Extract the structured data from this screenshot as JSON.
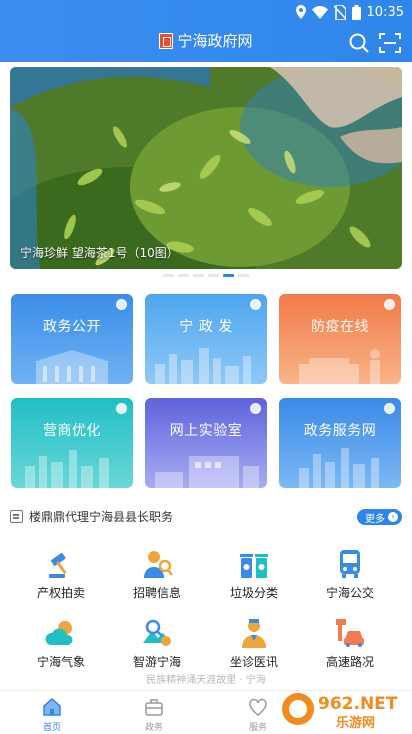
{
  "status_bar": {
    "time": "10:35"
  },
  "app_bar": {
    "title": "宁海政府网"
  },
  "banner": {
    "caption": "宁海珍鲜  望海茶1号（10图）",
    "dot_count": 6,
    "active_dot": 5
  },
  "tiles": [
    {
      "label": "政务公开",
      "color": "#3e90e6"
    },
    {
      "label": "宁 政 发",
      "color": "#4fa8ef"
    },
    {
      "label": "防疫在线",
      "color": "#f07c4f"
    },
    {
      "label": "营商优化",
      "color": "#1fc1c6"
    },
    {
      "label": "网上实验室",
      "color": "#6a70e4"
    },
    {
      "label": "政务服务网",
      "color": "#3a8ce8"
    }
  ],
  "news": {
    "text": "楼鼎鼎代理宁海县县长职务",
    "more_label": "更多"
  },
  "services": [
    {
      "label": "产权拍卖",
      "icon": "gavel-icon"
    },
    {
      "label": "招聘信息",
      "icon": "recruit-icon"
    },
    {
      "label": "垃圾分类",
      "icon": "trash-bins-icon"
    },
    {
      "label": "宁海公交",
      "icon": "bus-icon"
    },
    {
      "label": "宁海气象",
      "icon": "weather-icon"
    },
    {
      "label": "智游宁海",
      "icon": "tourism-icon"
    },
    {
      "label": "坐诊医讯",
      "icon": "doctor-icon"
    },
    {
      "label": "高速路况",
      "icon": "highway-icon"
    }
  ],
  "footer_note": "民族精神涌天涯故里 · 宁海",
  "bottom_nav": [
    {
      "label": "首页",
      "active": true
    },
    {
      "label": "政务",
      "active": false
    },
    {
      "label": "服务",
      "active": false
    }
  ],
  "watermark": {
    "text": "962.NET",
    "subtext": "乐游网"
  },
  "colors": {
    "accent": "#2f86ea",
    "header": "#3b8ef0"
  }
}
